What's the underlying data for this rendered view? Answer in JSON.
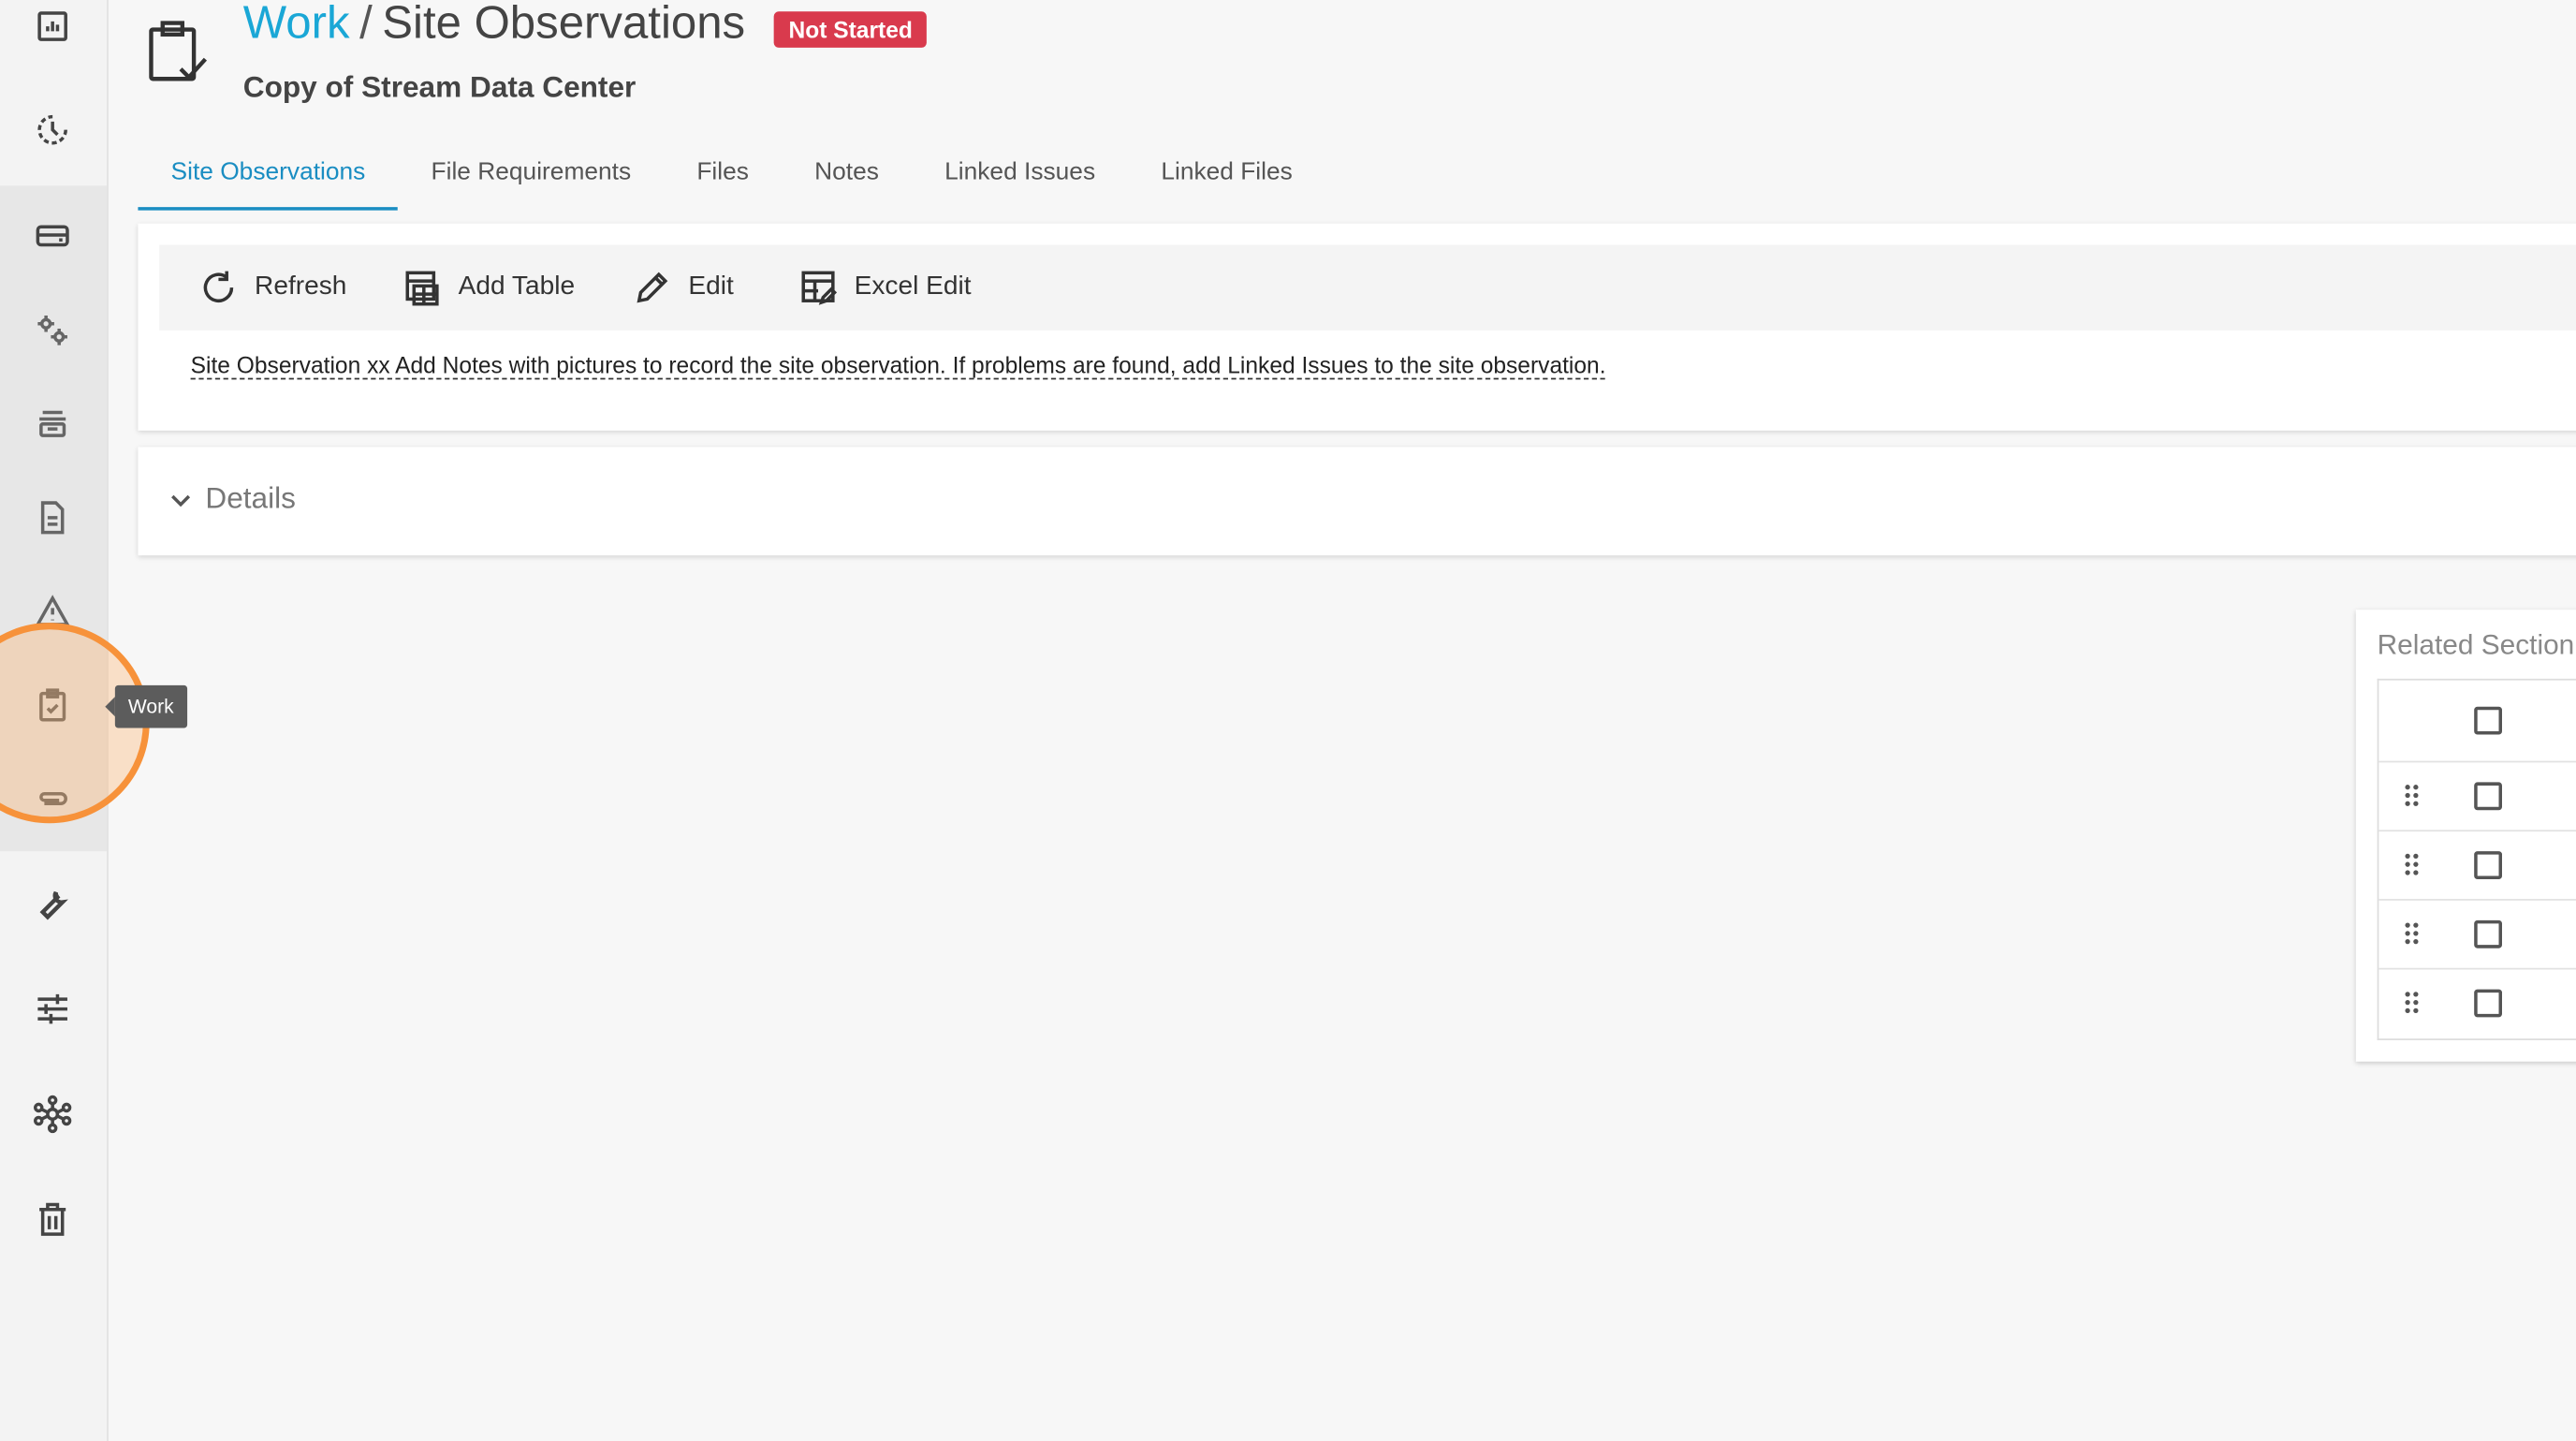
{
  "header": {
    "breadcrumb_root": "Work",
    "separator": "/",
    "page_title": "Site Observations",
    "status_badge": "Not Started",
    "subtitle": "Copy of Stream Data Center"
  },
  "tabs": [
    {
      "label": "Site Observations",
      "active": true
    },
    {
      "label": "File Requirements",
      "active": false
    },
    {
      "label": "Files",
      "active": false
    },
    {
      "label": "Notes",
      "active": false
    },
    {
      "label": "Linked Issues",
      "active": false
    },
    {
      "label": "Linked Files",
      "active": false
    }
  ],
  "toolbar": {
    "refresh_label": "Refresh",
    "add_table_label": "Add Table",
    "edit_label": "Edit",
    "excel_edit_label": "Excel Edit"
  },
  "description": "Site Observation xx Add Notes with pictures to record the site observation. If problems are found, add Linked Issues to the site observation.",
  "details": {
    "label": "Details"
  },
  "related": {
    "title": "Related Section"
  },
  "sidebar": {
    "icons": [
      "dashboard-icon",
      "schedule-icon",
      "inbox-icon",
      "settings-gears-icon",
      "stack-icon",
      "document-icon",
      "warning-icon",
      "clipboard-check-icon",
      "attachment-icon",
      "wrench-icon",
      "sliders-icon",
      "network-icon",
      "trash-icon"
    ],
    "tooltip": "Work"
  },
  "colors": {
    "accent": "#1aa7d6",
    "active_tab": "#1a8dc2",
    "status_not_started": "#d93a4d",
    "highlight_ring": "#f7923a"
  }
}
